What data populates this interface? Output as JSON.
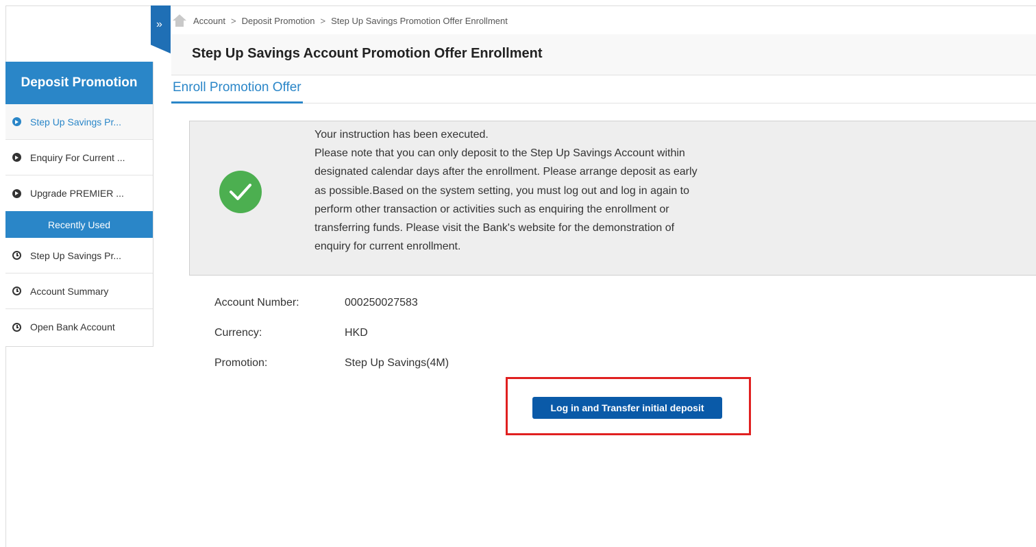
{
  "breadcrumb": {
    "items": [
      "Account",
      "Deposit Promotion",
      "Step Up Savings Promotion Offer Enrollment"
    ],
    "separator": ">"
  },
  "collapse_toggle": {
    "glyph": "»"
  },
  "page": {
    "title": "Step Up Savings Account Promotion Offer Enrollment",
    "active_tab": "Enroll Promotion Offer"
  },
  "sidebar": {
    "header": "Deposit Promotion",
    "items": [
      {
        "label": "Step Up Savings Pr...",
        "icon": "play-circle-icon",
        "active": true
      },
      {
        "label": "Enquiry For Current ...",
        "icon": "play-circle-icon",
        "active": false
      },
      {
        "label": "Upgrade PREMIER ...",
        "icon": "play-circle-icon",
        "active": false
      }
    ],
    "recent_header": "Recently Used",
    "recent_items": [
      {
        "label": "Step Up Savings Pr...",
        "icon": "clock-icon"
      },
      {
        "label": "Account Summary",
        "icon": "clock-icon"
      },
      {
        "label": "Open Bank Account",
        "icon": "clock-icon"
      }
    ]
  },
  "success": {
    "icon": "check-circle-icon",
    "lines": [
      "Your instruction has been executed.",
      "Please note that you can only deposit to the Step Up Savings Account within",
      "designated calendar days after the enrollment. Please arrange deposit as early",
      "as possible.Based on the system setting, you must log out and log in again to",
      "perform other transaction or activities such as enquiring the enrollment or",
      "transferring funds. Please visit the Bank's website for the demonstration of",
      "enquiry for current enrollment."
    ]
  },
  "details": [
    {
      "label": "Account Number:",
      "value": "000250027583"
    },
    {
      "label": "Currency:",
      "value": "HKD"
    },
    {
      "label": "Promotion:",
      "value": "Step Up Savings(4M)"
    }
  ],
  "action": {
    "button_label": "Log in and Transfer initial deposit"
  },
  "colors": {
    "primary_blue": "#2a86c8",
    "button_blue": "#0a5aa8",
    "success_green": "#4caf50",
    "highlight_red": "#e02020"
  }
}
